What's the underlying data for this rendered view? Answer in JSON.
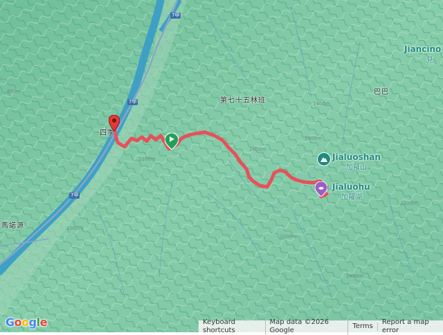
{
  "map": {
    "places": {
      "peak_en": "Jialuoshan",
      "peak_zh": "加羅山",
      "lake_en": "Jialuohu",
      "lake_zh": "加羅湖",
      "north_en": "Jiancino",
      "north_zh": "見"
    },
    "areas": {
      "forest_class": "第七十五林班",
      "baba": "巴巴",
      "manuoyuan": "馬諾源",
      "simu": "四季"
    },
    "road_shield": "7甲",
    "contours": [
      "1200m",
      "1400m",
      "1600m",
      "1800m",
      "2000m",
      "2200m",
      "2400m",
      "1000m",
      "800m"
    ]
  },
  "footer": {
    "keyboard": "Keyboard shortcuts",
    "map_data": "Map data ©2026 Google",
    "terms": "Terms",
    "report": "Report a map error"
  },
  "google_logo": "Google",
  "colors": {
    "track": "#e8505b",
    "terrain": "#7fc7a6",
    "river": "#3fa0c6",
    "road": "#8aa6c6",
    "place": "#1e8c7e"
  },
  "icons": {
    "start": "start-flag-icon",
    "end": "end-pin-icon",
    "peak": "mountain-peak-icon",
    "lake": "lake-icon"
  }
}
